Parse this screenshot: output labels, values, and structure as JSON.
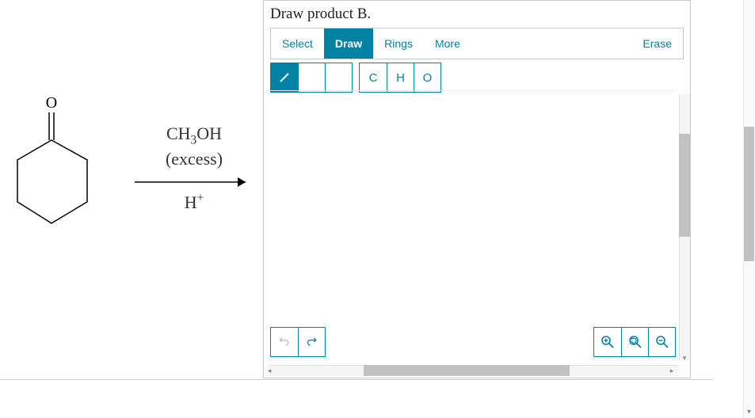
{
  "editor": {
    "title": "Draw product B.",
    "tabs": {
      "select": "Select",
      "draw": "Draw",
      "rings": "Rings",
      "more": "More",
      "erase": "Erase"
    },
    "bond_tools": {
      "single": "/",
      "double": "//",
      "triple": "///"
    },
    "atom_tools": {
      "c": "C",
      "h": "H",
      "o": "O"
    },
    "controls": {
      "undo": "↶",
      "redo": "↷",
      "zoom_in": "⊕",
      "reset_zoom": "↺",
      "zoom_out": "⊖"
    }
  },
  "reaction": {
    "reagent_line1_html": "CH<sub>3</sub>OH",
    "reagent_line2": "(excess)",
    "catalyst_html": "H<sup>+</sup>",
    "o_label": "O"
  }
}
